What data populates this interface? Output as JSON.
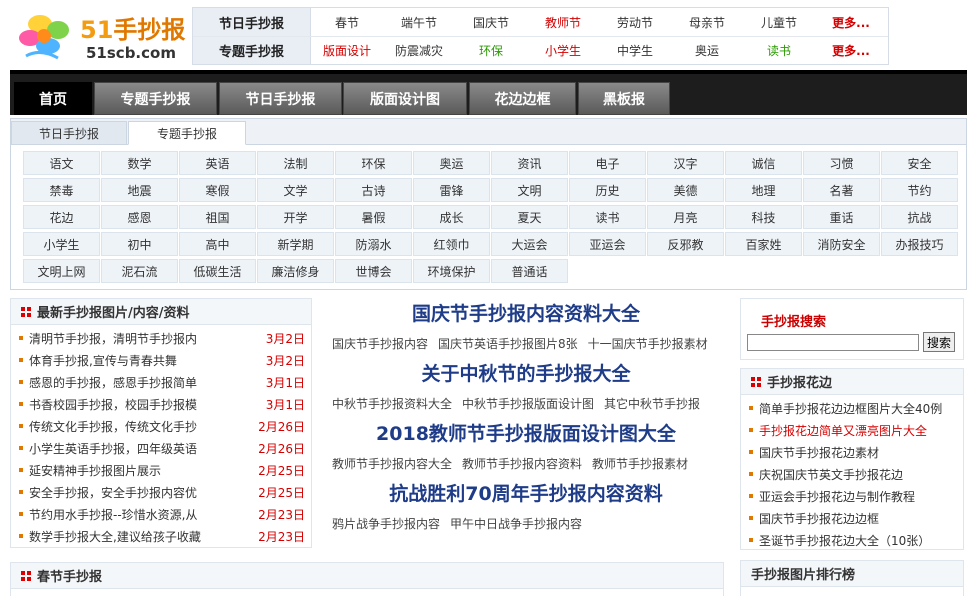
{
  "logo": {
    "brand_num": "51",
    "brand_text": "手抄报",
    "domain": "51scb.com"
  },
  "topnav": {
    "rows": [
      {
        "head": "节日手抄报",
        "links": [
          {
            "label": "春节",
            "tone": "dark"
          },
          {
            "label": "端午节",
            "tone": "dark"
          },
          {
            "label": "国庆节",
            "tone": "dark"
          },
          {
            "label": "教师节",
            "tone": "red"
          },
          {
            "label": "劳动节",
            "tone": "dark"
          },
          {
            "label": "母亲节",
            "tone": "dark"
          },
          {
            "label": "儿童节",
            "tone": "dark"
          },
          {
            "label": "更多...",
            "tone": "more"
          }
        ]
      },
      {
        "head": "专题手抄报",
        "links": [
          {
            "label": "版面设计",
            "tone": "red"
          },
          {
            "label": "防震减灾",
            "tone": "dark"
          },
          {
            "label": "环保",
            "tone": "green"
          },
          {
            "label": "小学生",
            "tone": "red"
          },
          {
            "label": "中学生",
            "tone": "dark"
          },
          {
            "label": "奥运",
            "tone": "dark"
          },
          {
            "label": "读书",
            "tone": "green"
          },
          {
            "label": "更多...",
            "tone": "more"
          }
        ]
      }
    ]
  },
  "mainnav": [
    "首页",
    "专题手抄报",
    "节日手抄报",
    "版面设计图",
    "花边边框",
    "黑板报"
  ],
  "subtabs": [
    "节日手抄报",
    "专题手抄报"
  ],
  "topics": [
    "语文",
    "数学",
    "英语",
    "法制",
    "环保",
    "奥运",
    "资讯",
    "电子",
    "汉字",
    "诚信",
    "习惯",
    "安全",
    "禁毒",
    "地震",
    "寒假",
    "文学",
    "古诗",
    "雷锋",
    "文明",
    "历史",
    "美德",
    "地理",
    "名著",
    "节约",
    "花边",
    "感恩",
    "祖国",
    "开学",
    "暑假",
    "成长",
    "夏天",
    "读书",
    "月亮",
    "科技",
    "重话",
    "抗战",
    "小学生",
    "初中",
    "高中",
    "新学期",
    "防溺水",
    "红领巾",
    "大运会",
    "亚运会",
    "反邪教",
    "百家姓",
    "消防安全",
    "办报技巧",
    "文明上网",
    "泥石流",
    "低碳生活",
    "廉洁修身",
    "世博会",
    "环境保护",
    "普通话"
  ],
  "latest": {
    "title": "最新手抄报图片/内容/资料",
    "items": [
      {
        "title": "清明节手抄报，清明节手抄报内",
        "date": "3月2日"
      },
      {
        "title": "体育手抄报,宣传与青春共舞",
        "date": "3月2日"
      },
      {
        "title": "感恩的手抄报，感恩手抄报简单",
        "date": "3月1日"
      },
      {
        "title": "书香校园手抄报，校园手抄报模",
        "date": "3月1日"
      },
      {
        "title": "传统文化手抄报，传统文化手抄",
        "date": "2月26日"
      },
      {
        "title": "小学生英语手抄报，四年级英语",
        "date": "2月26日"
      },
      {
        "title": "延安精神手抄报图片展示",
        "date": "2月25日"
      },
      {
        "title": "安全手抄报，安全手抄报内容优",
        "date": "2月25日"
      },
      {
        "title": "节约用水手抄报--珍惜水资源,从",
        "date": "2月23日"
      },
      {
        "title": "数学手抄报大全,建议给孩子收藏",
        "date": "2月23日"
      }
    ]
  },
  "features": [
    {
      "title": "国庆节手抄报内容资料大全",
      "subs": [
        "国庆节手抄报内容",
        "国庆节英语手抄报图片8张",
        "十一国庆节手抄报素材"
      ]
    },
    {
      "title": "关于中秋节的手抄报大全",
      "subs": [
        "中秋节手抄报资料大全",
        "中秋节手抄报版面设计图",
        "其它中秋节手抄报"
      ]
    },
    {
      "title": "2018教师节手抄报版面设计图大全",
      "subs": [
        "教师节手抄报内容大全",
        "教师节手抄报内容资料",
        "教师节手抄报素材"
      ]
    },
    {
      "title": "抗战胜利70周年手抄报内容资料",
      "subs": [
        "鸦片战争手抄报内容",
        "甲午中日战争手抄报内容"
      ]
    }
  ],
  "search": {
    "label": "手抄报搜索",
    "button": "搜索",
    "value": ""
  },
  "borders": {
    "title": "手抄报花边",
    "items": [
      {
        "label": "简单手抄报花边边框图片大全40例",
        "hl": false
      },
      {
        "label": "手抄报花边简单又漂亮图片大全",
        "hl": true
      },
      {
        "label": "国庆节手抄报花边素材",
        "hl": false
      },
      {
        "label": "庆祝国庆节英文手抄报花边",
        "hl": false
      },
      {
        "label": "亚运会手抄报花边与制作教程",
        "hl": false
      },
      {
        "label": "国庆节手抄报花边边框",
        "hl": false
      },
      {
        "label": "圣诞节手抄报花边大全（10张）",
        "hl": false
      }
    ]
  },
  "spring": {
    "title": "春节手抄报"
  },
  "ranking": {
    "title": "手抄报图片排行榜"
  },
  "colors": {
    "accent": "#d40000",
    "nav_bg": "#1d1d1d",
    "link_blue": "#1f3c88"
  }
}
